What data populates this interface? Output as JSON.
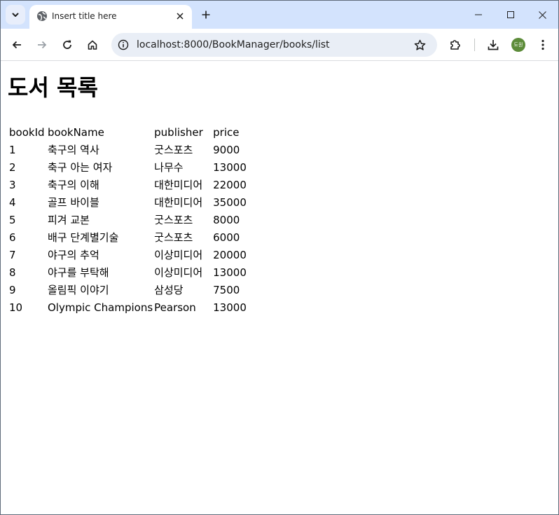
{
  "browser": {
    "tab_title": "Insert title here",
    "url": "localhost:8000/BookManager/books/list",
    "profile_initials": "도원"
  },
  "colors": {
    "tabstrip_bg": "#d3e3fd",
    "omnibox_bg": "#e9eef6",
    "avatar_bg": "#5d8c3a"
  },
  "icons": {
    "tab_search": "chevron-down-icon",
    "favicon": "globe-icon",
    "close": "close-icon",
    "new_tab": "plus-icon",
    "back": "arrow-left-icon",
    "forward": "arrow-right-icon",
    "reload": "reload-icon",
    "home": "home-icon",
    "info": "info-icon",
    "bookmark": "star-icon",
    "extensions": "puzzle-icon",
    "downloads": "download-icon",
    "menu": "kebab-icon"
  },
  "page": {
    "heading": "도서 목록",
    "table": {
      "headers": [
        "bookId",
        "bookName",
        "publisher",
        "price"
      ],
      "rows": [
        [
          "1",
          "축구의 역사",
          "굿스포츠",
          "9000"
        ],
        [
          "2",
          "축구 아는 여자",
          "나무수",
          "13000"
        ],
        [
          "3",
          "축구의 이해",
          "대한미디어",
          "22000"
        ],
        [
          "4",
          "골프 바이블",
          "대한미디어",
          "35000"
        ],
        [
          "5",
          "피겨 교본",
          "굿스포츠",
          "8000"
        ],
        [
          "6",
          "배구 단계별기술",
          "굿스포츠",
          "6000"
        ],
        [
          "7",
          "야구의 추억",
          "이상미디어",
          "20000"
        ],
        [
          "8",
          "야구를 부탁해",
          "이상미디어",
          "13000"
        ],
        [
          "9",
          "올림픽 이야기",
          "삼성당",
          "7500"
        ],
        [
          "10",
          "Olympic Champions",
          "Pearson",
          "13000"
        ]
      ]
    }
  }
}
